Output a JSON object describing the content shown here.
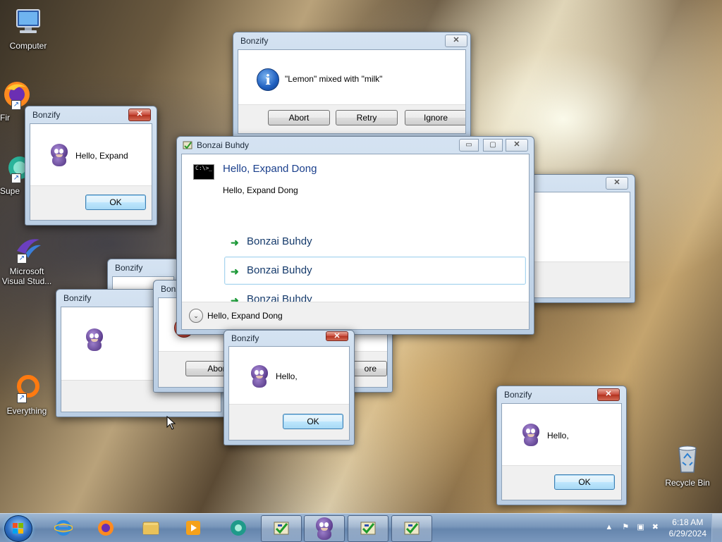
{
  "desktop": {
    "icons": [
      {
        "label": "Computer",
        "icon": "computer-icon"
      },
      {
        "label": "Fir",
        "icon": "firefox-icon"
      },
      {
        "label": "Supe",
        "icon": "app-icon"
      },
      {
        "label": "Microsoft Visual Stud...",
        "icon": "visual-studio-icon"
      },
      {
        "label": "Everything",
        "icon": "everything-search-icon"
      },
      {
        "label": "Recycle Bin",
        "icon": "recycle-bin-icon"
      }
    ]
  },
  "windows": {
    "info_dialog": {
      "title": "Bonzify",
      "message": "\"Lemon\" mixed with \"milk\"",
      "buttons": [
        "Abort",
        "Retry",
        "Ignore"
      ],
      "close": "✕"
    },
    "hello_expand": {
      "title": "Bonzify",
      "message": "Hello, Expand",
      "ok": "OK",
      "close": "✕"
    },
    "bonzi_small_a": {
      "title": "Bonzify"
    },
    "bonzi_small_b": {
      "title": "Bonzify"
    },
    "bonzi_small_c": {
      "title": "Bonz",
      "button_left": "Abor",
      "button_right": "ore"
    },
    "hello_center": {
      "title": "Bonzify",
      "message": "Hello,",
      "ok": "OK",
      "close": "✕"
    },
    "hello_right": {
      "title": "Bonzify",
      "message": "Hello,",
      "ok": "OK",
      "close": "✕"
    },
    "task_dialog": {
      "title": "Bonzai Buhdy",
      "heading": "Hello, Expand Dong",
      "content": "Hello, Expand Dong",
      "command_links": [
        "Bonzai Buhdy",
        "Bonzai Buhdy",
        "Bonzai Buhdy"
      ],
      "expander_label": "Hello, Expand Dong",
      "controls": {
        "minimize": "▭",
        "maximize": "▢",
        "close": "✕"
      }
    }
  },
  "taskbar": {
    "pinned": [
      "internet-explorer-icon",
      "firefox-icon",
      "file-explorer-icon",
      "media-player-icon",
      "app-icon"
    ],
    "open_buttons": [
      "checklist-app-icon",
      "bonzi-icon",
      "checklist-app-icon",
      "checklist-app-icon"
    ],
    "time": "6:18 AM",
    "date": "6/29/2024"
  }
}
